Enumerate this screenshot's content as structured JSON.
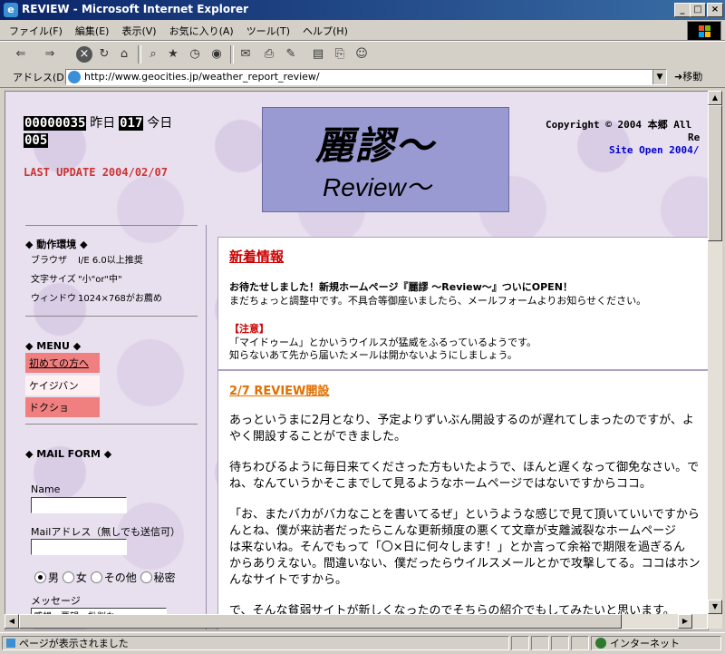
{
  "window": {
    "title": "REVIEW - Microsoft Internet Explorer",
    "icon_letter": "e",
    "minimize": "_",
    "maximize": "□",
    "close": "×"
  },
  "menu": [
    "ファイル(F)",
    "編集(E)",
    "表示(V)",
    "お気に入り(A)",
    "ツール(T)",
    "ヘルプ(H)"
  ],
  "toolbar": {
    "icons": [
      "back-icon",
      "forward-icon",
      "stop-icon",
      "refresh-icon",
      "home-icon",
      "search-icon",
      "favorites-icon",
      "history-icon",
      "mail-icon",
      "print-icon",
      "edit-icon",
      "discuss-icon",
      "messenger-icon"
    ]
  },
  "address": {
    "label": "アドレス(D)",
    "url": "http://www.geocities.jp/weather_report_review/",
    "go": "移動"
  },
  "page": {
    "counter_total": "00000035",
    "yesterday_label": "昨日",
    "counter_yesterday": "017",
    "today_label": "今日",
    "counter_today": "005",
    "last_update": "LAST UPDATE 2004/02/07",
    "logo_jp": "麗謬～",
    "logo_en": "Review～",
    "copyright_line1": "Copyright © 2004 本郷 All",
    "copyright_line2": "Re",
    "site_open": "Site Open 2004/",
    "env": {
      "heading": "◆ 動作環境 ◆",
      "rows": [
        {
          "k": "ブラウザ",
          "v": "I/E 6.0以上推奨"
        },
        {
          "k": "文字サイズ",
          "v": "\"小\"or\"中\""
        },
        {
          "k": "ウィンドウ",
          "v": "1024×768がお薦め"
        }
      ]
    },
    "menu": {
      "heading": "◆ MENU ◆",
      "items": [
        "初めての方へ",
        "ケイジバン",
        "ドクショ"
      ]
    },
    "mailform": {
      "heading": "◆ MAIL FORM ◆",
      "name_label": "Name",
      "mail_label": "Mailアドレス（無しでも送信可）",
      "radios": [
        "男",
        "女",
        "その他",
        "秘密"
      ],
      "selected": "男",
      "message_label": "メッセージ",
      "message_value": "感想、要望、批判な"
    },
    "news": {
      "heading": "新着情報",
      "bold_line": "お待たせしました！新規ホームページ『麗謬 ～Review～』ついにOPEN！",
      "line2": "まだちょっと調整中です。不具合等御座いましたら、メールフォームよりお知らせください。",
      "warn_label": "【注意】",
      "warn_line1": "「マイドゥーム」とかいうウイルスが猛威をふるっているようです。",
      "warn_line2": "知らないあて先から届いたメールは開かないようにしましょう。"
    },
    "entry": {
      "heading": "2/7 REVIEW開設",
      "paragraphs": [
        "あっというまに2月となり、予定よりずいぶん開設するのが遅れてしまったのですが、よ",
        "やく開設することができました。",
        "待ちわびるように毎日来てくださった方もいたようで、ほんと遅くなって御免なさい。で",
        "ね、なんていうかそこまでして見るようなホームページではないですからココ。",
        "「お、またバカがバカなことを書いてるぜ」というような感じで見て頂いていいですから",
        "んとね、僕が来訪者だったらこんな更新頻度の悪くて文章が支離滅裂なホームページ",
        "は来ないね。そんでもって「〇×日に何々します！」とか言って余裕で期限を過ぎるん",
        "からありえない。間違いない、僕だったらウイルスメールとかで攻撃してる。ココはホン",
        "んなサイトですから。",
        "で、そんな貧弱サイトが新しくなったのでそちらの紹介でもしてみたいと思います。"
      ]
    }
  },
  "status": {
    "text": "ページが表示されました",
    "zone": "インターネット"
  },
  "colors": {
    "titlebar": "#0a246a",
    "page_bg": "#e8e0ef",
    "logo_bg": "#9a9ad2",
    "menu_item_pink": "#f08080",
    "news_heading": "#cc0000",
    "entry_heading": "#e07000",
    "site_open": "#0000cc"
  }
}
